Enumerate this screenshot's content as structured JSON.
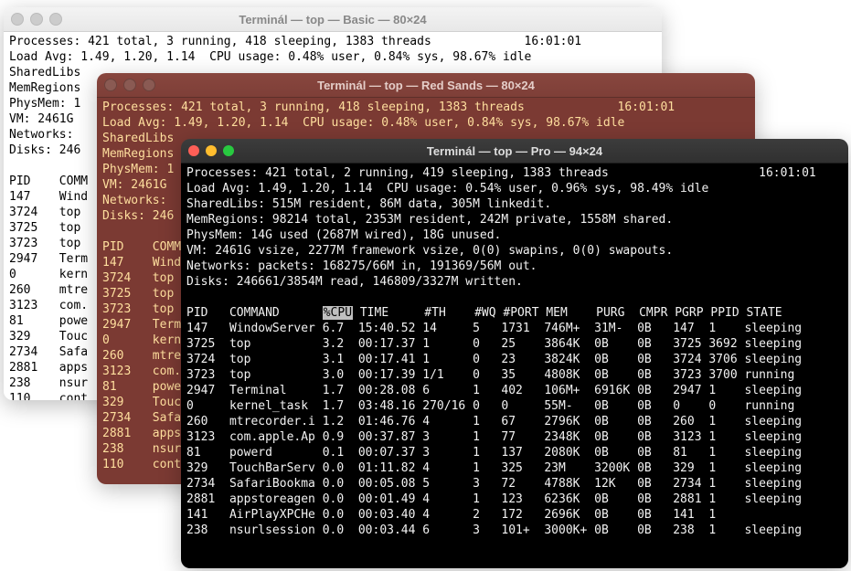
{
  "windows": {
    "basic": {
      "title": "Terminál — top — Basic — 80×24",
      "timestamp": "16:01:01",
      "header": {
        "processes": "Processes: 421 total, 3 running, 418 sleeping, 1383 threads",
        "loadavg": "Load Avg: 1.49, 1.20, 1.14  CPU usage: 0.48% user, 0.84% sys, 98.67% idle",
        "sharedlibs": "SharedLibs",
        "memregions": "MemRegions",
        "physmem": "PhysMem: 1",
        "vm": "VM: 2461G",
        "networks": "Networks:",
        "disks": "Disks: 246"
      },
      "columns": "PID    COMM",
      "rows": [
        "147    Wind",
        "3724   top",
        "3725   top",
        "3723   top",
        "2947   Term",
        "0      kern",
        "260    mtre",
        "3123   com.",
        "81     powe",
        "329    Touc",
        "2734   Safa",
        "2881   apps",
        "238    nsur",
        "110    cont"
      ]
    },
    "red": {
      "title": "Terminál — top — Red Sands — 80×24",
      "timestamp": "16:01:01",
      "header": {
        "processes": "Processes: 421 total, 3 running, 418 sleeping, 1383 threads",
        "loadavg": "Load Avg: 1.49, 1.20, 1.14  CPU usage: 0.48% user, 0.84% sys, 98.67% idle",
        "sharedlibs": "SharedLibs",
        "memregions": "MemRegions",
        "physmem": "PhysMem: 1",
        "vm": "VM: 2461G",
        "networks": "Networks:",
        "disks": "Disks: 246"
      },
      "columns": "PID    COMM",
      "rows": [
        "147    Windo",
        "3724   top",
        "3725   top",
        "3723   top",
        "2947   Termi",
        "0      kerne",
        "260    mtrec",
        "3123   com.a",
        "81     power",
        "329    Touch",
        "2734   Safar",
        "2881   appst",
        "238    nsurl",
        "110    conte"
      ]
    },
    "pro": {
      "title": "Terminál — top — Pro — 94×24",
      "timestamp": "16:01:01",
      "header_lines": [
        "Processes: 421 total, 2 running, 419 sleeping, 1383 threads",
        "Load Avg: 1.49, 1.20, 1.14  CPU usage: 0.54% user, 0.96% sys, 98.49% idle",
        "SharedLibs: 515M resident, 86M data, 305M linkedit.",
        "MemRegions: 98214 total, 2353M resident, 242M private, 1558M shared.",
        "PhysMem: 14G used (2687M wired), 18G unused.",
        "VM: 2461G vsize, 2277M framework vsize, 0(0) swapins, 0(0) swapouts.",
        "Networks: packets: 168275/66M in, 191369/56M out.",
        "Disks: 246661/3854M read, 146809/3327M written."
      ],
      "columns": {
        "pid": "PID",
        "command": "COMMAND",
        "cpu": "%CPU",
        "time": "TIME",
        "th": "#TH",
        "wq": "#WQ",
        "port": "#PORT",
        "mem": "MEM",
        "purg": "PURG",
        "cmpr": "CMPR",
        "pgrp": "PGRP",
        "ppid": "PPID",
        "state": "STATE"
      },
      "rows": [
        {
          "pid": "147",
          "cmd": "WindowServer",
          "cpu": "6.7",
          "time": "15:40.52",
          "th": "14",
          "wq": "5",
          "port": "1731",
          "mem": "746M+",
          "purg": "31M-",
          "cmpr": "0B",
          "pgrp": "147",
          "ppid": "1",
          "state": "sleeping"
        },
        {
          "pid": "3725",
          "cmd": "top",
          "cpu": "3.2",
          "time": "00:17.37",
          "th": "1",
          "wq": "0",
          "port": "25",
          "mem": "3864K",
          "purg": "0B",
          "cmpr": "0B",
          "pgrp": "3725",
          "ppid": "3692",
          "state": "sleeping"
        },
        {
          "pid": "3724",
          "cmd": "top",
          "cpu": "3.1",
          "time": "00:17.41",
          "th": "1",
          "wq": "0",
          "port": "23",
          "mem": "3824K",
          "purg": "0B",
          "cmpr": "0B",
          "pgrp": "3724",
          "ppid": "3706",
          "state": "sleeping"
        },
        {
          "pid": "3723",
          "cmd": "top",
          "cpu": "3.0",
          "time": "00:17.39",
          "th": "1/1",
          "wq": "0",
          "port": "35",
          "mem": "4808K",
          "purg": "0B",
          "cmpr": "0B",
          "pgrp": "3723",
          "ppid": "3700",
          "state": "running"
        },
        {
          "pid": "2947",
          "cmd": "Terminal",
          "cpu": "1.7",
          "time": "00:28.08",
          "th": "6",
          "wq": "1",
          "port": "402",
          "mem": "106M+",
          "purg": "6916K",
          "cmpr": "0B",
          "pgrp": "2947",
          "ppid": "1",
          "state": "sleeping"
        },
        {
          "pid": "0",
          "cmd": "kernel_task",
          "cpu": "1.7",
          "time": "03:48.16",
          "th": "270/16",
          "wq": "0",
          "port": "0",
          "mem": "55M-",
          "purg": "0B",
          "cmpr": "0B",
          "pgrp": "0",
          "ppid": "0",
          "state": "running"
        },
        {
          "pid": "260",
          "cmd": "mtrecorder.i",
          "cpu": "1.2",
          "time": "01:46.76",
          "th": "4",
          "wq": "1",
          "port": "67",
          "mem": "2796K",
          "purg": "0B",
          "cmpr": "0B",
          "pgrp": "260",
          "ppid": "1",
          "state": "sleeping"
        },
        {
          "pid": "3123",
          "cmd": "com.apple.Ap",
          "cpu": "0.9",
          "time": "00:37.87",
          "th": "3",
          "wq": "1",
          "port": "77",
          "mem": "2348K",
          "purg": "0B",
          "cmpr": "0B",
          "pgrp": "3123",
          "ppid": "1",
          "state": "sleeping"
        },
        {
          "pid": "81",
          "cmd": "powerd",
          "cpu": "0.1",
          "time": "00:07.37",
          "th": "3",
          "wq": "1",
          "port": "137",
          "mem": "2080K",
          "purg": "0B",
          "cmpr": "0B",
          "pgrp": "81",
          "ppid": "1",
          "state": "sleeping"
        },
        {
          "pid": "329",
          "cmd": "TouchBarServ",
          "cpu": "0.0",
          "time": "01:11.82",
          "th": "4",
          "wq": "1",
          "port": "325",
          "mem": "23M",
          "purg": "3200K",
          "cmpr": "0B",
          "pgrp": "329",
          "ppid": "1",
          "state": "sleeping"
        },
        {
          "pid": "2734",
          "cmd": "SafariBookma",
          "cpu": "0.0",
          "time": "00:05.08",
          "th": "5",
          "wq": "3",
          "port": "72",
          "mem": "4788K",
          "purg": "12K",
          "cmpr": "0B",
          "pgrp": "2734",
          "ppid": "1",
          "state": "sleeping"
        },
        {
          "pid": "2881",
          "cmd": "appstoreagen",
          "cpu": "0.0",
          "time": "00:01.49",
          "th": "4",
          "wq": "1",
          "port": "123",
          "mem": "6236K",
          "purg": "0B",
          "cmpr": "0B",
          "pgrp": "2881",
          "ppid": "1",
          "state": "sleeping"
        },
        {
          "pid": "141",
          "cmd": "AirPlayXPCHe",
          "cpu": "0.0",
          "time": "00:03.40",
          "th": "4",
          "wq": "2",
          "port": "172",
          "mem": "2696K",
          "purg": "0B",
          "cmpr": "0B",
          "pgrp": "141",
          "ppid": "1",
          "state": ""
        },
        {
          "pid": "238",
          "cmd": "nsurlsession",
          "cpu": "0.0",
          "time": "00:03.44",
          "th": "6",
          "wq": "3",
          "port": "101+",
          "mem": "3000K+",
          "purg": "0B",
          "cmpr": "0B",
          "pgrp": "238",
          "ppid": "1",
          "state": "sleeping"
        }
      ]
    }
  }
}
